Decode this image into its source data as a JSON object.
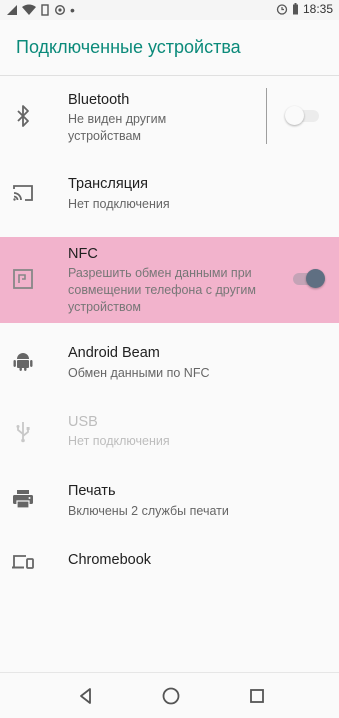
{
  "status_bar": {
    "time": "18:35"
  },
  "header": {
    "title": "Подключенные устройства"
  },
  "items": [
    {
      "title": "Bluetooth",
      "subtitle": "Не виден другим устройствам",
      "icon": "bluetooth-icon",
      "toggle": false
    },
    {
      "title": "Трансляция",
      "subtitle": "Нет подключения",
      "icon": "cast-icon"
    },
    {
      "title": "NFC",
      "subtitle": "Разрешить обмен данными при совмещении телефона с другим устройством",
      "icon": "nfc-icon",
      "toggle": true
    },
    {
      "title": "Android Beam",
      "subtitle": "Обмен данными по NFC",
      "icon": "android-icon"
    },
    {
      "title": "USB",
      "subtitle": "Нет подключения",
      "icon": "usb-icon",
      "disabled": true
    },
    {
      "title": "Печать",
      "subtitle": "Включены 2 службы печати",
      "icon": "print-icon"
    },
    {
      "title": "Chromebook",
      "subtitle": "",
      "icon": "devices-icon"
    }
  ],
  "colors": {
    "accent": "#0b8a7a",
    "highlight": "#f2b3cc",
    "switch_on": "#5f6f82",
    "switch_off": "#ececec"
  }
}
